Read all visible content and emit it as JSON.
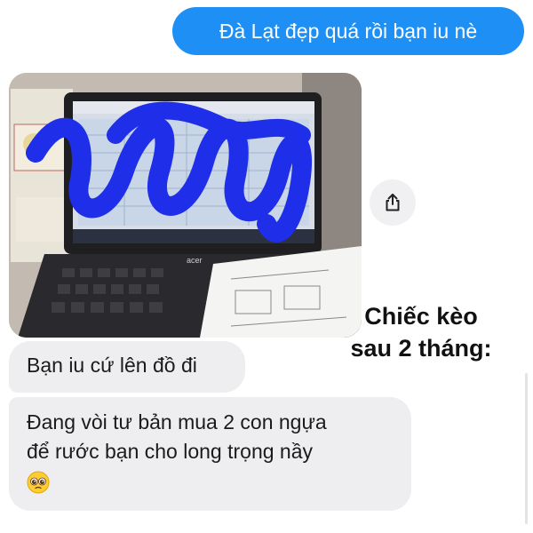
{
  "conversation": {
    "outgoing_message": "Đà Lạt đẹp quá rồi bạn iu nè",
    "incoming_messages": [
      {
        "text": "Bạn iu cứ lên đồ đi"
      },
      {
        "line1": "Đang vòi tư bản mua 2 con ngựa",
        "line2": "để rước bạn cho long trọng nầy",
        "emoji": "pleading-face-icon"
      }
    ]
  },
  "photo": {
    "laptop_brand": "acer",
    "notes": "Scribbled-out laptop screen on a desk with a desk calendar and a worksheet"
  },
  "overlay_caption": {
    "line1": "Chiếc kèo",
    "line2": "sau 2 tháng:"
  },
  "colors": {
    "outgoing_bubble": "#1e90f5",
    "incoming_bubble": "#eeeef0",
    "scribble": "#1f2ee8"
  }
}
